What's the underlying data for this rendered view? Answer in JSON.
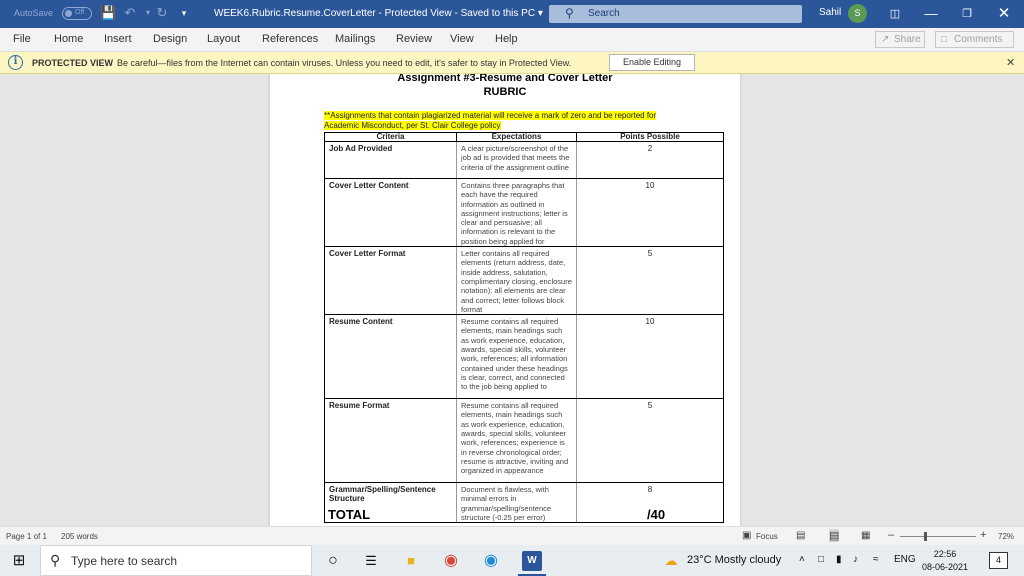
{
  "titlebar": {
    "autosave_label": "AutoSave",
    "autosave_state": "Off",
    "doc_title": "WEEK6.Rubric.Resume.CoverLetter  -  Protected View  -  Saved to this PC  ▾",
    "search_placeholder": "Search",
    "user_name": "Sahil",
    "user_initial": "S"
  },
  "menu": {
    "items": [
      "File",
      "Home",
      "Insert",
      "Design",
      "Layout",
      "References",
      "Mailings",
      "Review",
      "View",
      "Help"
    ],
    "share_label": "Share",
    "comments_label": "Comments"
  },
  "protected": {
    "title": "PROTECTED VIEW",
    "message": "Be careful—files from the Internet can contain viruses. Unless you need to edit, it's safer to stay in Protected View.",
    "enable_label": "Enable Editing"
  },
  "document": {
    "heading": "Assignment #3-Resume and Cover Letter",
    "subheading": "RUBRIC",
    "warning": "**Assignments that contain plagiarized material will receive a mark of zero and be reported for Academic Misconduct, per St. Clair College policy",
    "columns": [
      "Criteria",
      "Expectations",
      "Points Possible"
    ],
    "rows": [
      {
        "criteria": "Job Ad Provided",
        "expectations": "A clear picture/screenshot of the job ad is provided that meets the criteria of the assignment outline",
        "points": "2"
      },
      {
        "criteria": "Cover Letter Content",
        "expectations": "Contains three paragraphs that each have the required information as outlined in assignment instructions; letter is clear and persuasive; all information is relevant to the position being applied for",
        "points": "10"
      },
      {
        "criteria": "Cover Letter Format",
        "expectations": "Letter contains all required elements (return address, date, inside address, salutation, complimentary closing, enclosure notation); all elements are clear and correct; letter follows block format",
        "points": "5"
      },
      {
        "criteria": "Resume Content",
        "expectations": "Resume contains all required elements, main headings such as work experience, education, awards, special skills, volunteer work, references; all information contained under these headings is clear, correct, and connected to the job being applied to",
        "points": "10"
      },
      {
        "criteria": "Resume Format",
        "expectations": "Resume contains all required elements, main headings such as work experience, education, awards, special skills, volunteer work, references; experience is in reverse chronological order; resume is attractive, inviting and organized in appearance",
        "points": "5"
      },
      {
        "criteria": "Grammar/Spelling/Sentence Structure",
        "expectations": "Document is flawless, with minimal errors in grammar/spelling/sentence structure (-0.25 per error)",
        "points": "8"
      }
    ],
    "total_label": "TOTAL",
    "total_value": "/40"
  },
  "status": {
    "page": "Page 1 of 1",
    "words": "205 words",
    "focus": "Focus",
    "zoom": "72%",
    "zoom_fraction": 0.72
  },
  "taskbar": {
    "search_placeholder": "Type here to search",
    "weather": "23°C  Mostly cloudy",
    "lang": "ENG",
    "time": "22:56",
    "date": "08-06-2021",
    "notifications": "4"
  }
}
